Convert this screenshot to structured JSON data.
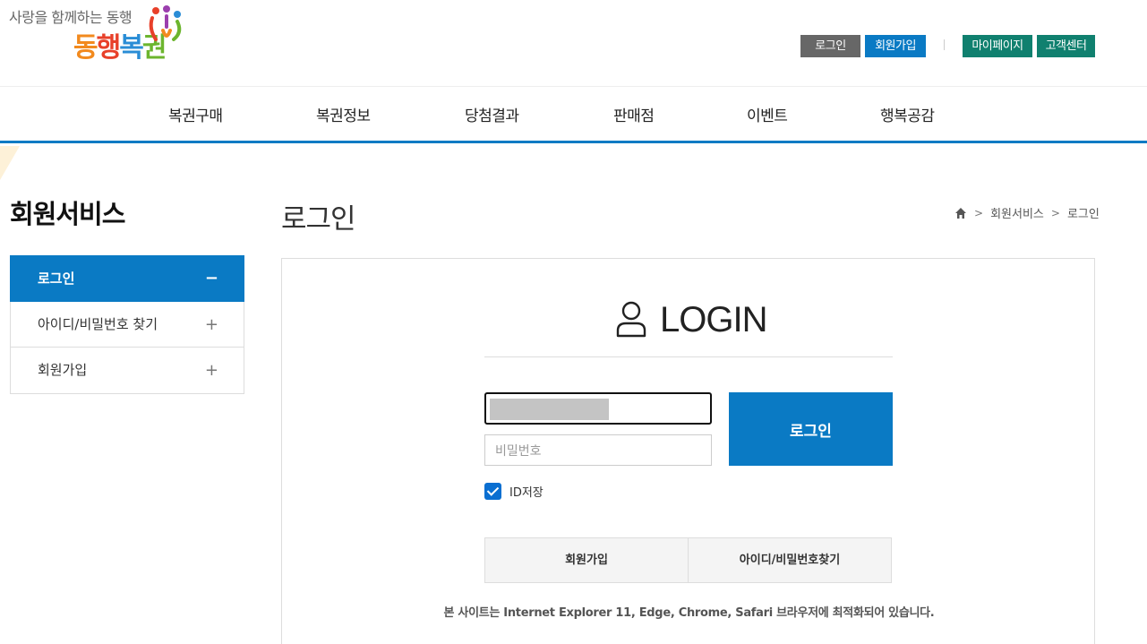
{
  "logo": {
    "tagline": "사랑을 함께하는 동행",
    "title_parts": [
      "동",
      "행",
      "복",
      "권"
    ]
  },
  "utility": {
    "login": "로그인",
    "join": "회원가입",
    "mypage": "마이페이지",
    "customer_center": "고객센터"
  },
  "nav": {
    "items": [
      "복권구매",
      "복권정보",
      "당첨결과",
      "판매점",
      "이벤트",
      "행복공감"
    ]
  },
  "sidebar": {
    "title": "회원서비스",
    "items": [
      {
        "label": "로그인",
        "sign": "−"
      },
      {
        "label": "아이디/비밀번호 찾기",
        "sign": "+"
      },
      {
        "label": "회원가입",
        "sign": "+"
      }
    ]
  },
  "page": {
    "title": "로그인",
    "breadcrumb": [
      "회원서비스",
      "로그인"
    ]
  },
  "login": {
    "heading": "LOGIN",
    "id_value": "",
    "password_placeholder": "비밀번호",
    "submit_label": "로그인",
    "save_id_label": "ID저장",
    "save_id_checked": true,
    "join_link": "회원가입",
    "find_link": "아이디/비밀번호찾기",
    "browser_note": "본 사이트는 Internet Explorer 11, Edge, Chrome, Safari 브라우저에 최적화되어 있습니다."
  },
  "colors": {
    "primary": "#0a7ac4",
    "teal": "#10806f",
    "gray_button": "#676767"
  }
}
